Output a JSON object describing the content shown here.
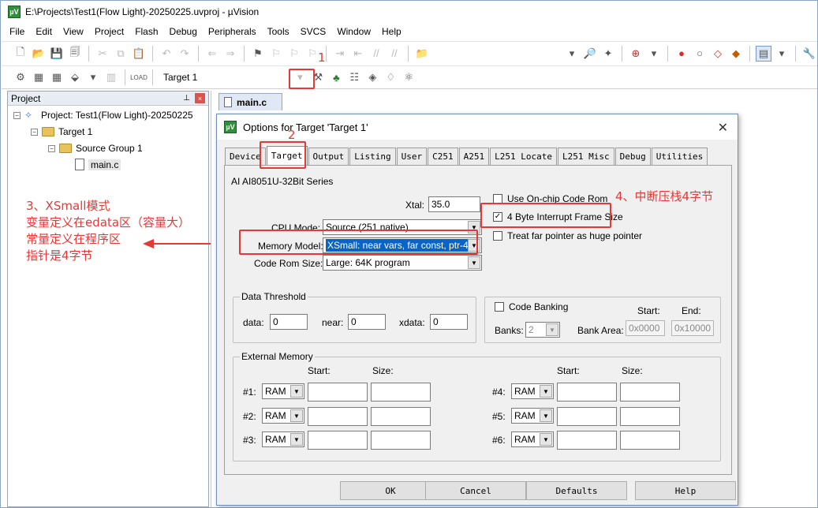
{
  "window": {
    "title": "E:\\Projects\\Test1(Flow Light)-20250225.uvproj - µVision",
    "app_icon": "µV"
  },
  "menu": [
    "File",
    "Edit",
    "View",
    "Project",
    "Flash",
    "Debug",
    "Peripherals",
    "Tools",
    "SVCS",
    "Window",
    "Help"
  ],
  "toolbar2": {
    "target_name": "Target 1"
  },
  "project_pane": {
    "title": "Project",
    "tree": {
      "root": "Project: Test1(Flow Light)-20250225",
      "target": "Target 1",
      "group": "Source Group 1",
      "file": "main.c"
    }
  },
  "editor": {
    "tab": "main.c"
  },
  "annotations": {
    "n1": "1",
    "n2": "2",
    "note3": [
      "3、XSmall模式",
      "变量定义在edata区（容量大）",
      "常量定义在程序区",
      "指针是4字节"
    ],
    "note4": "4、中断压栈4字节"
  },
  "dialog": {
    "title": "Options for Target 'Target 1'",
    "tabs": [
      "Device",
      "Target",
      "Output",
      "Listing",
      "User",
      "C251",
      "A251",
      "L251 Locate",
      "L251 Misc",
      "Debug",
      "Utilities"
    ],
    "active_tab": "Target",
    "device_name": "AI AI8051U-32Bit Series",
    "xtal": {
      "label": "Xtal:",
      "value": "35.0"
    },
    "cpu_mode": {
      "label": "CPU Mode:",
      "value": "Source (251 native)"
    },
    "memory_model": {
      "label": "Memory Model:",
      "value": "XSmall: near vars, far const, ptr-4"
    },
    "code_rom_size": {
      "label": "Code Rom Size:",
      "value": "Large: 64K program"
    },
    "checks": [
      {
        "label": "Use On-chip Code Rom",
        "checked": false
      },
      {
        "label": "4 Byte Interrupt Frame Size",
        "checked": true
      },
      {
        "label": "Treat far pointer as huge pointer",
        "checked": false
      }
    ],
    "data_threshold": {
      "title": "Data Threshold",
      "data_label": "data:",
      "data": "0",
      "near_label": "near:",
      "near": "0",
      "xdata_label": "xdata:",
      "xdata": "0"
    },
    "code_banking": {
      "label": "Code Banking",
      "checked": false,
      "start_label": "Start:",
      "end_label": "End:",
      "banks_label": "Banks:",
      "banks": "2",
      "bank_area_label": "Bank Area:",
      "start": "0x0000",
      "end": "0x10000"
    },
    "external_memory": {
      "title": "External Memory",
      "start_label": "Start:",
      "size_label": "Size:",
      "rows": [
        {
          "label": "#1:",
          "type": "RAM"
        },
        {
          "label": "#2:",
          "type": "RAM"
        },
        {
          "label": "#3:",
          "type": "RAM"
        },
        {
          "label": "#4:",
          "type": "RAM"
        },
        {
          "label": "#5:",
          "type": "RAM"
        },
        {
          "label": "#6:",
          "type": "RAM"
        }
      ]
    },
    "buttons": {
      "ok": "OK",
      "cancel": "Cancel",
      "defaults": "Defaults",
      "help": "Help"
    }
  }
}
